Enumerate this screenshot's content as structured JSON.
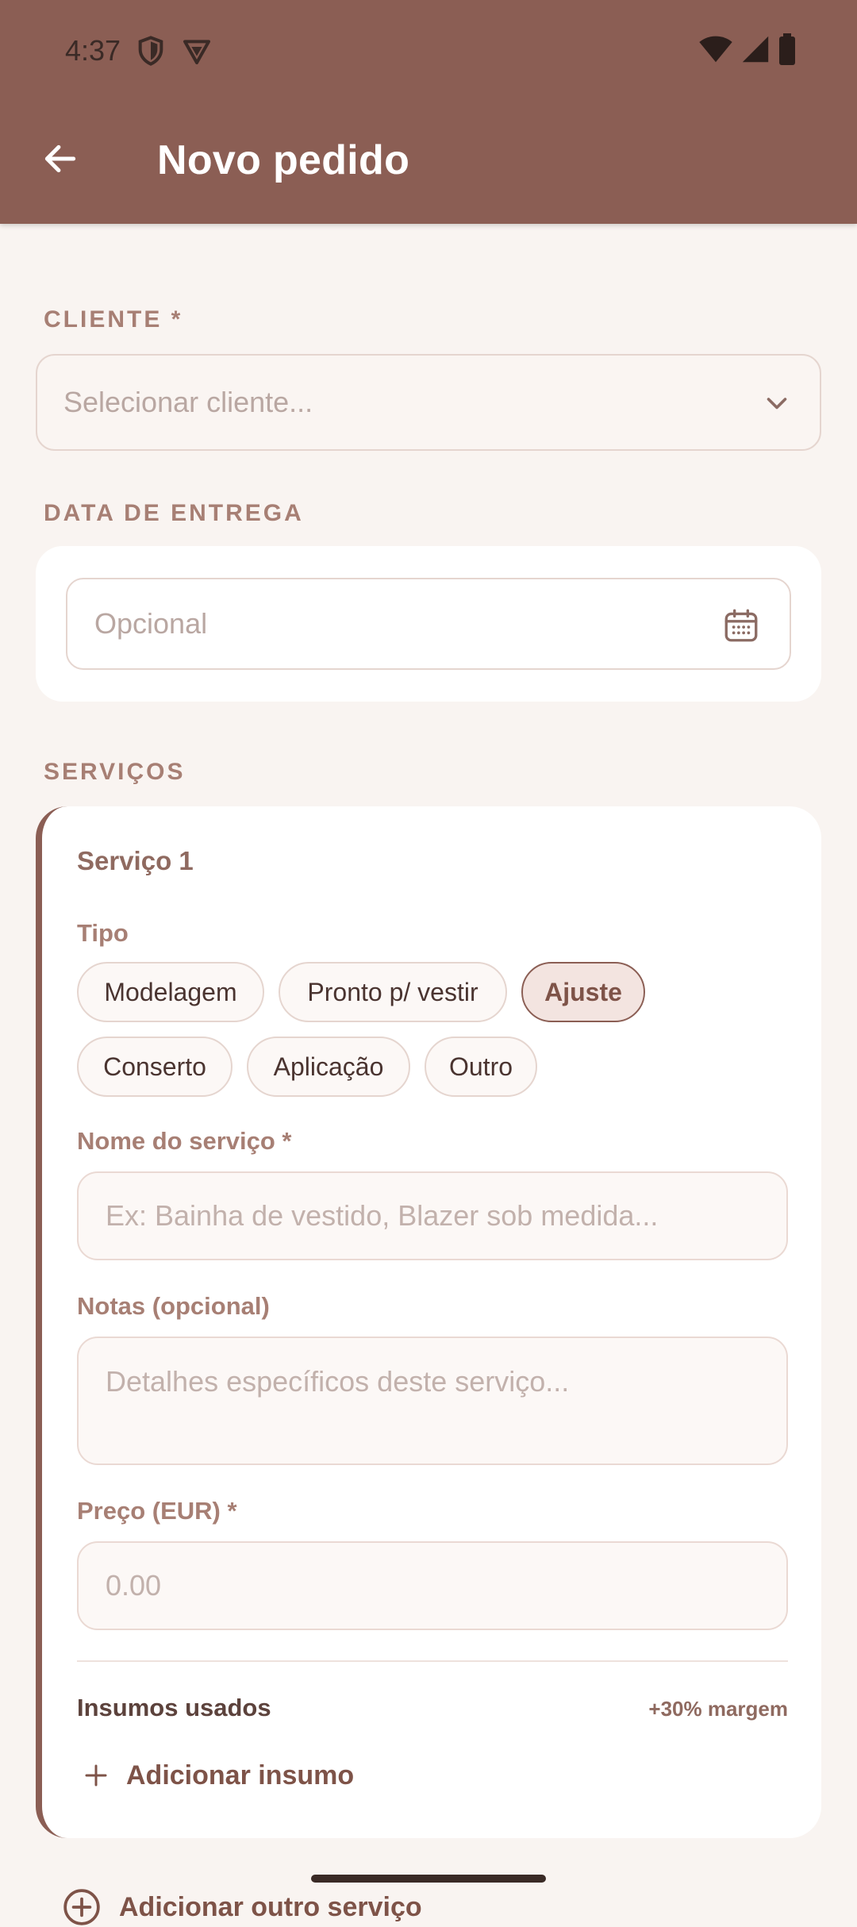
{
  "status_bar": {
    "time": "4:37"
  },
  "app_bar": {
    "title": "Novo pedido",
    "back_icon": "arrow-left-icon"
  },
  "cliente": {
    "label": "CLIENTE *",
    "placeholder": "Selecionar cliente..."
  },
  "entrega": {
    "label": "DATA DE ENTREGA",
    "placeholder": "Opcional"
  },
  "servicos": {
    "label": "SERVIÇOS",
    "service": {
      "title": "Serviço 1",
      "tipo_label": "Tipo",
      "chips": [
        "Modelagem",
        "Pronto p/ vestir",
        "Ajuste",
        "Conserto",
        "Aplicação",
        "Outro"
      ],
      "selected_chip": "Ajuste",
      "nome_label": "Nome do serviço *",
      "nome_placeholder": "Ex: Bainha de vestido, Blazer sob medida...",
      "notas_label": "Notas (opcional)",
      "notas_placeholder": "Detalhes específicos deste serviço...",
      "preco_label": "Preço (EUR) *",
      "preco_placeholder": "0.00",
      "insumos_label": "Insumos usados",
      "margem_label": "+30% margem",
      "add_insumo_label": "Adicionar insumo"
    },
    "add_service_label": "Adicionar outro serviço"
  },
  "colors": {
    "primary": "#8b5e54",
    "background": "#f9f4f1",
    "label": "#a77f74"
  }
}
